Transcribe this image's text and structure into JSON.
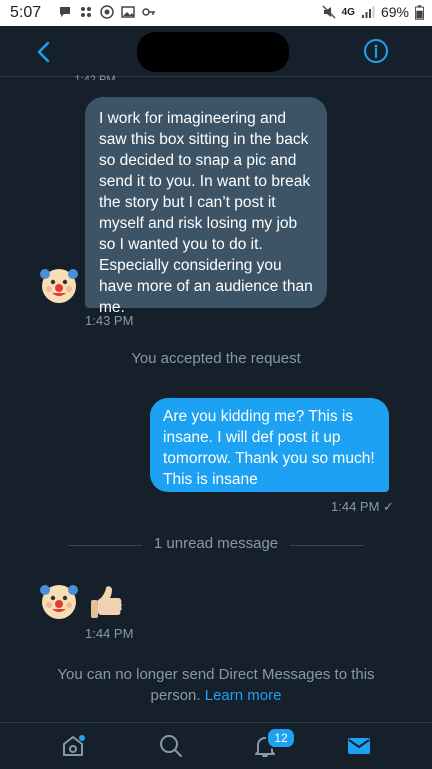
{
  "status_bar": {
    "time": "5:07",
    "network": "4G",
    "battery": "69%",
    "icons": [
      "chat-bubble-icon",
      "dots-icon",
      "target-icon",
      "image-icon",
      "key-icon",
      "mute-icon",
      "signal-icon",
      "battery-icon"
    ]
  },
  "header": {
    "back_icon": "chevron-left-icon",
    "info_icon": "info-circle-icon",
    "accent": "#1da1f2"
  },
  "conversation": {
    "top_timestamp_partial": "1:42 PM",
    "incoming_1": {
      "text": "I work for imagineering and saw this box sitting in the back so decided to snap a pic and send it to you. In want to break the story but I can’t post it myself and risk losing my job so I wanted you to do it. Especially considering you have more of an audience than me.",
      "time": "1:43 PM",
      "avatar": "clown-face-avatar"
    },
    "system_accepted": "You accepted the request",
    "outgoing_1": {
      "text": "Are you kidding me? This is insane. I will def post it up tomorrow. Thank you so much! This is insane",
      "time": "1:44 PM ✓"
    },
    "unread_divider": "1 unread message",
    "incoming_2": {
      "emoji": "thumbs-up-icon",
      "time": "1:44 PM",
      "avatar": "clown-face-avatar"
    },
    "notice": {
      "text": "You can no longer send Direct Messages to this person.",
      "link": "Learn more"
    }
  },
  "tabbar": {
    "home_icon": "home-icon",
    "search_icon": "search-icon",
    "notifications_icon": "bell-icon",
    "notifications_badge": "12",
    "messages_icon": "envelope-icon"
  },
  "colors": {
    "background": "#15202b",
    "incoming_bubble": "#3d5466",
    "outgoing_bubble": "#1da1f2",
    "muted_text": "#8899a6"
  }
}
